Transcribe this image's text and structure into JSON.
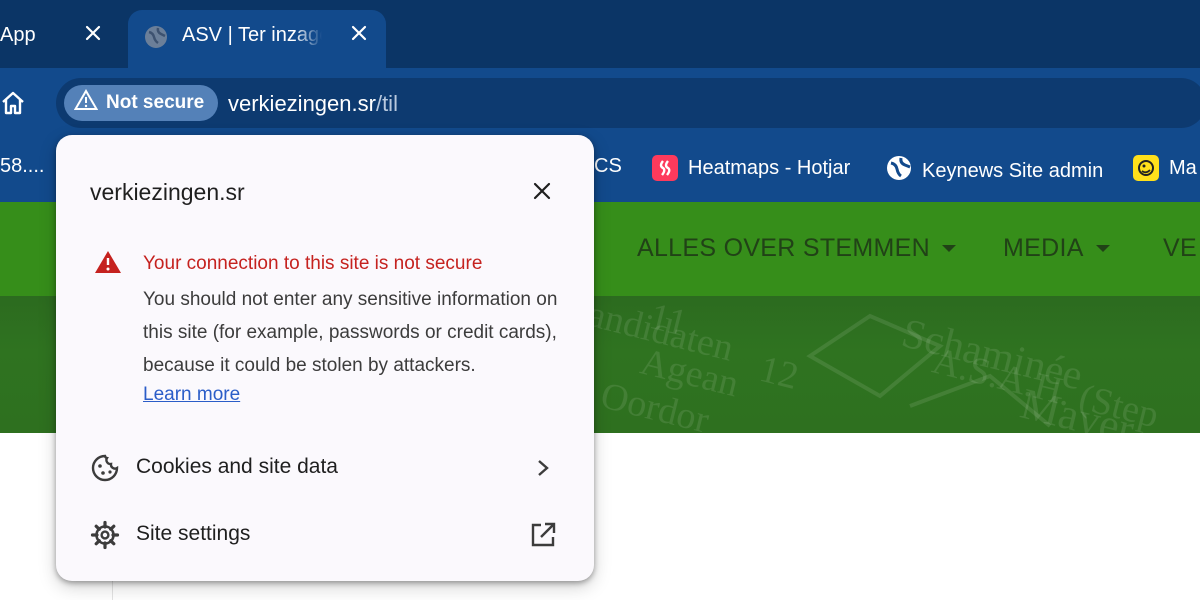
{
  "tabs": [
    {
      "title": "App",
      "close": "close-tab"
    },
    {
      "title": "ASV | Ter inzage legging",
      "close": "close-tab"
    }
  ],
  "toolbar": {
    "security_chip": "Not secure",
    "url_host": "verkiezingen.sr",
    "url_path": "/til"
  },
  "bookmarks": [
    {
      "label": "58....",
      "icon": "truncated-bookmark"
    },
    {
      "label": "CS",
      "icon": "hidden-bookmark"
    },
    {
      "label": "Heatmaps - Hotjar",
      "icon": "hotjar-icon",
      "color": "#fd3a5c"
    },
    {
      "label": "Keynews Site admin",
      "icon": "globe-icon"
    },
    {
      "label": "Ma",
      "icon": "mailchimp-icon",
      "color": "#ffe01b"
    }
  ],
  "site": {
    "nav": [
      {
        "label": "ALLES OVER STEMMEN",
        "dropdown": true
      },
      {
        "label": "MEDIA",
        "dropdown": true
      },
      {
        "label": "VE",
        "dropdown": false
      }
    ],
    "banner_text": [
      "Kandidaten",
      "Schaminée",
      "A.S.A.H. (Step",
      "11",
      "Mayer",
      "Oordor",
      "Agean",
      "12"
    ],
    "colors": {
      "navbar": "#368e1a",
      "banner": "#2e701f"
    }
  },
  "popup": {
    "title": "verkiezingen.sr",
    "warning_heading": "Your connection to this site is not secure",
    "warning_body": "You should not enter any sensitive information on this site (for example, passwords or credit cards), because it could be stolen by attackers.",
    "learn_more": "Learn more",
    "cookies_label": "Cookies and site data",
    "settings_label": "Site settings",
    "warning_color": "#c5221f"
  }
}
